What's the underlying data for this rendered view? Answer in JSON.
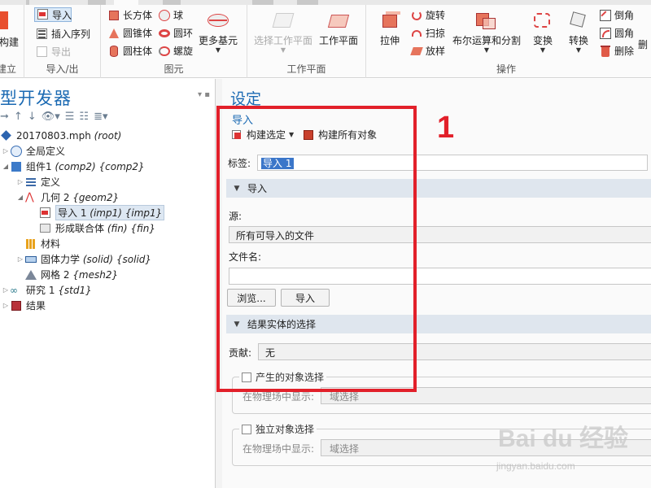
{
  "ribbon": {
    "groups": {
      "build": "建立",
      "import_export": "导入/出",
      "primitives": "图元",
      "workplane": "工作平面",
      "operations": "操作"
    },
    "buttons": {
      "build_all": "构建",
      "import": "导入",
      "insert_sequence": "插入序列",
      "export": "导出",
      "block": "长方体",
      "cone": "圆锥体",
      "cylinder": "圆柱体",
      "sphere": "球",
      "torus": "圆环",
      "helix": "螺旋",
      "more_primitives": "更多基元",
      "select_workplane": "选择工作平面",
      "workplane": "工作平面",
      "extrude": "拉伸",
      "revolve": "旋转",
      "sweep": "扫掠",
      "loft": "放样",
      "booleans": "布尔运算和分割",
      "transforms": "变换",
      "conversions": "转换",
      "chamfer": "倒角",
      "fillet": "圆角",
      "delete": "删除",
      "delete_trunc": "删"
    }
  },
  "model_builder": {
    "title": "型开发器",
    "tree": [
      {
        "label": "20170803.mph",
        "tag": "(root)"
      },
      {
        "label": "全局定义",
        "tag": ""
      },
      {
        "label": "组件1",
        "tag": "(comp2) {comp2}"
      },
      {
        "label": "定义",
        "tag": ""
      },
      {
        "label": "几何 2",
        "tag": "{geom2}"
      },
      {
        "label": "导入 1",
        "tag": "(imp1) {imp1}"
      },
      {
        "label": "形成联合体",
        "tag": "(fin) {fin}"
      },
      {
        "label": "材料",
        "tag": ""
      },
      {
        "label": "固体力学",
        "tag": "(solid) {solid}"
      },
      {
        "label": "网格 2",
        "tag": "{mesh2}"
      },
      {
        "label": "研究 1",
        "tag": "{std1}"
      },
      {
        "label": "结果",
        "tag": ""
      }
    ]
  },
  "settings": {
    "title": "设定",
    "node_name": "导入",
    "build_selected": "构建选定",
    "build_all_objects": "构建所有对象",
    "label_caption": "标签:",
    "label_value": "导入 1",
    "section_import": "导入",
    "source_caption": "源:",
    "source_value": "所有可导入的文件",
    "filename_caption": "文件名:",
    "browse": "浏览...",
    "import": "导入",
    "section_selections": "结果实体的选择",
    "contribute_caption": "贡献:",
    "contribute_value": "无",
    "resulting_objects": "产生的对象选择",
    "show_in_physics": "在物理场中显示:",
    "domain_selection": "域选择",
    "individual_objects": "独立对象选择",
    "show_in_physics_2": "在物理场中显示:",
    "domain_selection_2": "域选择"
  },
  "annotation": {
    "step_number": "1",
    "watermark": "Bai du 经验",
    "watermark_url": "jingyan.baidu.com"
  },
  "colors": {
    "title_blue": "#1b6ab3",
    "annotation_red": "#e2202a",
    "section_bg": "#dfe6ee"
  }
}
